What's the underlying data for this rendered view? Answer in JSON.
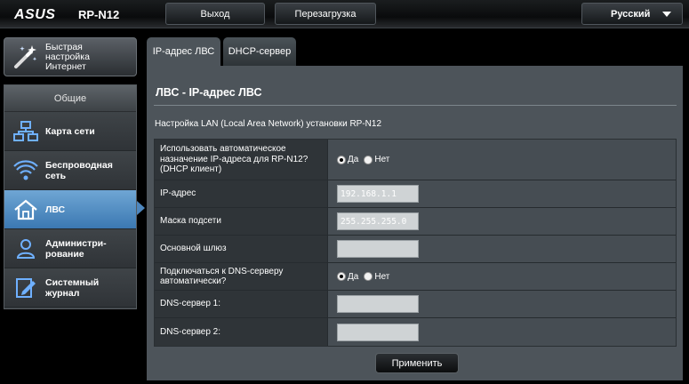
{
  "header": {
    "brand": "ASUS",
    "model": "RP-N12",
    "logout_label": "Выход",
    "reboot_label": "Перезагрузка",
    "language": "Русский"
  },
  "quick_setup": {
    "label": "Быстрая настройка Интернет"
  },
  "menu": {
    "heading": "Общие",
    "items": [
      {
        "label": "Карта сети",
        "icon": "network-map-icon"
      },
      {
        "label": "Беспроводная сеть",
        "icon": "wireless-icon"
      },
      {
        "label": "ЛВС",
        "icon": "home-icon",
        "active": true
      },
      {
        "label": "Администри-рование",
        "icon": "admin-user-icon"
      },
      {
        "label": "Системный журнал",
        "icon": "log-edit-icon"
      }
    ]
  },
  "tabs": [
    {
      "label": "IP-адрес ЛВС",
      "active": true
    },
    {
      "label": "DHCP-сервер",
      "active": false
    }
  ],
  "content": {
    "title": "ЛВС - IP-адрес ЛВС",
    "description": "Настройка LAN (Local Area Network) установки RP-N12",
    "rows": [
      {
        "label": "Использовать автоматическое назначение IP-адреса для RP-N12? (DHCP клиент)",
        "type": "radio",
        "yes": "Да",
        "no": "Нет",
        "selected": "yes"
      },
      {
        "label": "IP-адрес",
        "type": "input",
        "value": "192.168.1.1"
      },
      {
        "label": "Маска подсети",
        "type": "input",
        "value": "255.255.255.0"
      },
      {
        "label": "Основной шлюз",
        "type": "input",
        "value": ""
      },
      {
        "label": "Подключаться к DNS-серверу автоматически?",
        "type": "radio",
        "yes": "Да",
        "no": "Нет",
        "selected": "yes"
      },
      {
        "label": "DNS-сервер 1:",
        "type": "input",
        "value": ""
      },
      {
        "label": "DNS-сервер 2:",
        "type": "input",
        "value": ""
      }
    ],
    "apply_label": "Применить"
  },
  "colors": {
    "accent": "#4e86bd",
    "panel": "#4d545a"
  }
}
